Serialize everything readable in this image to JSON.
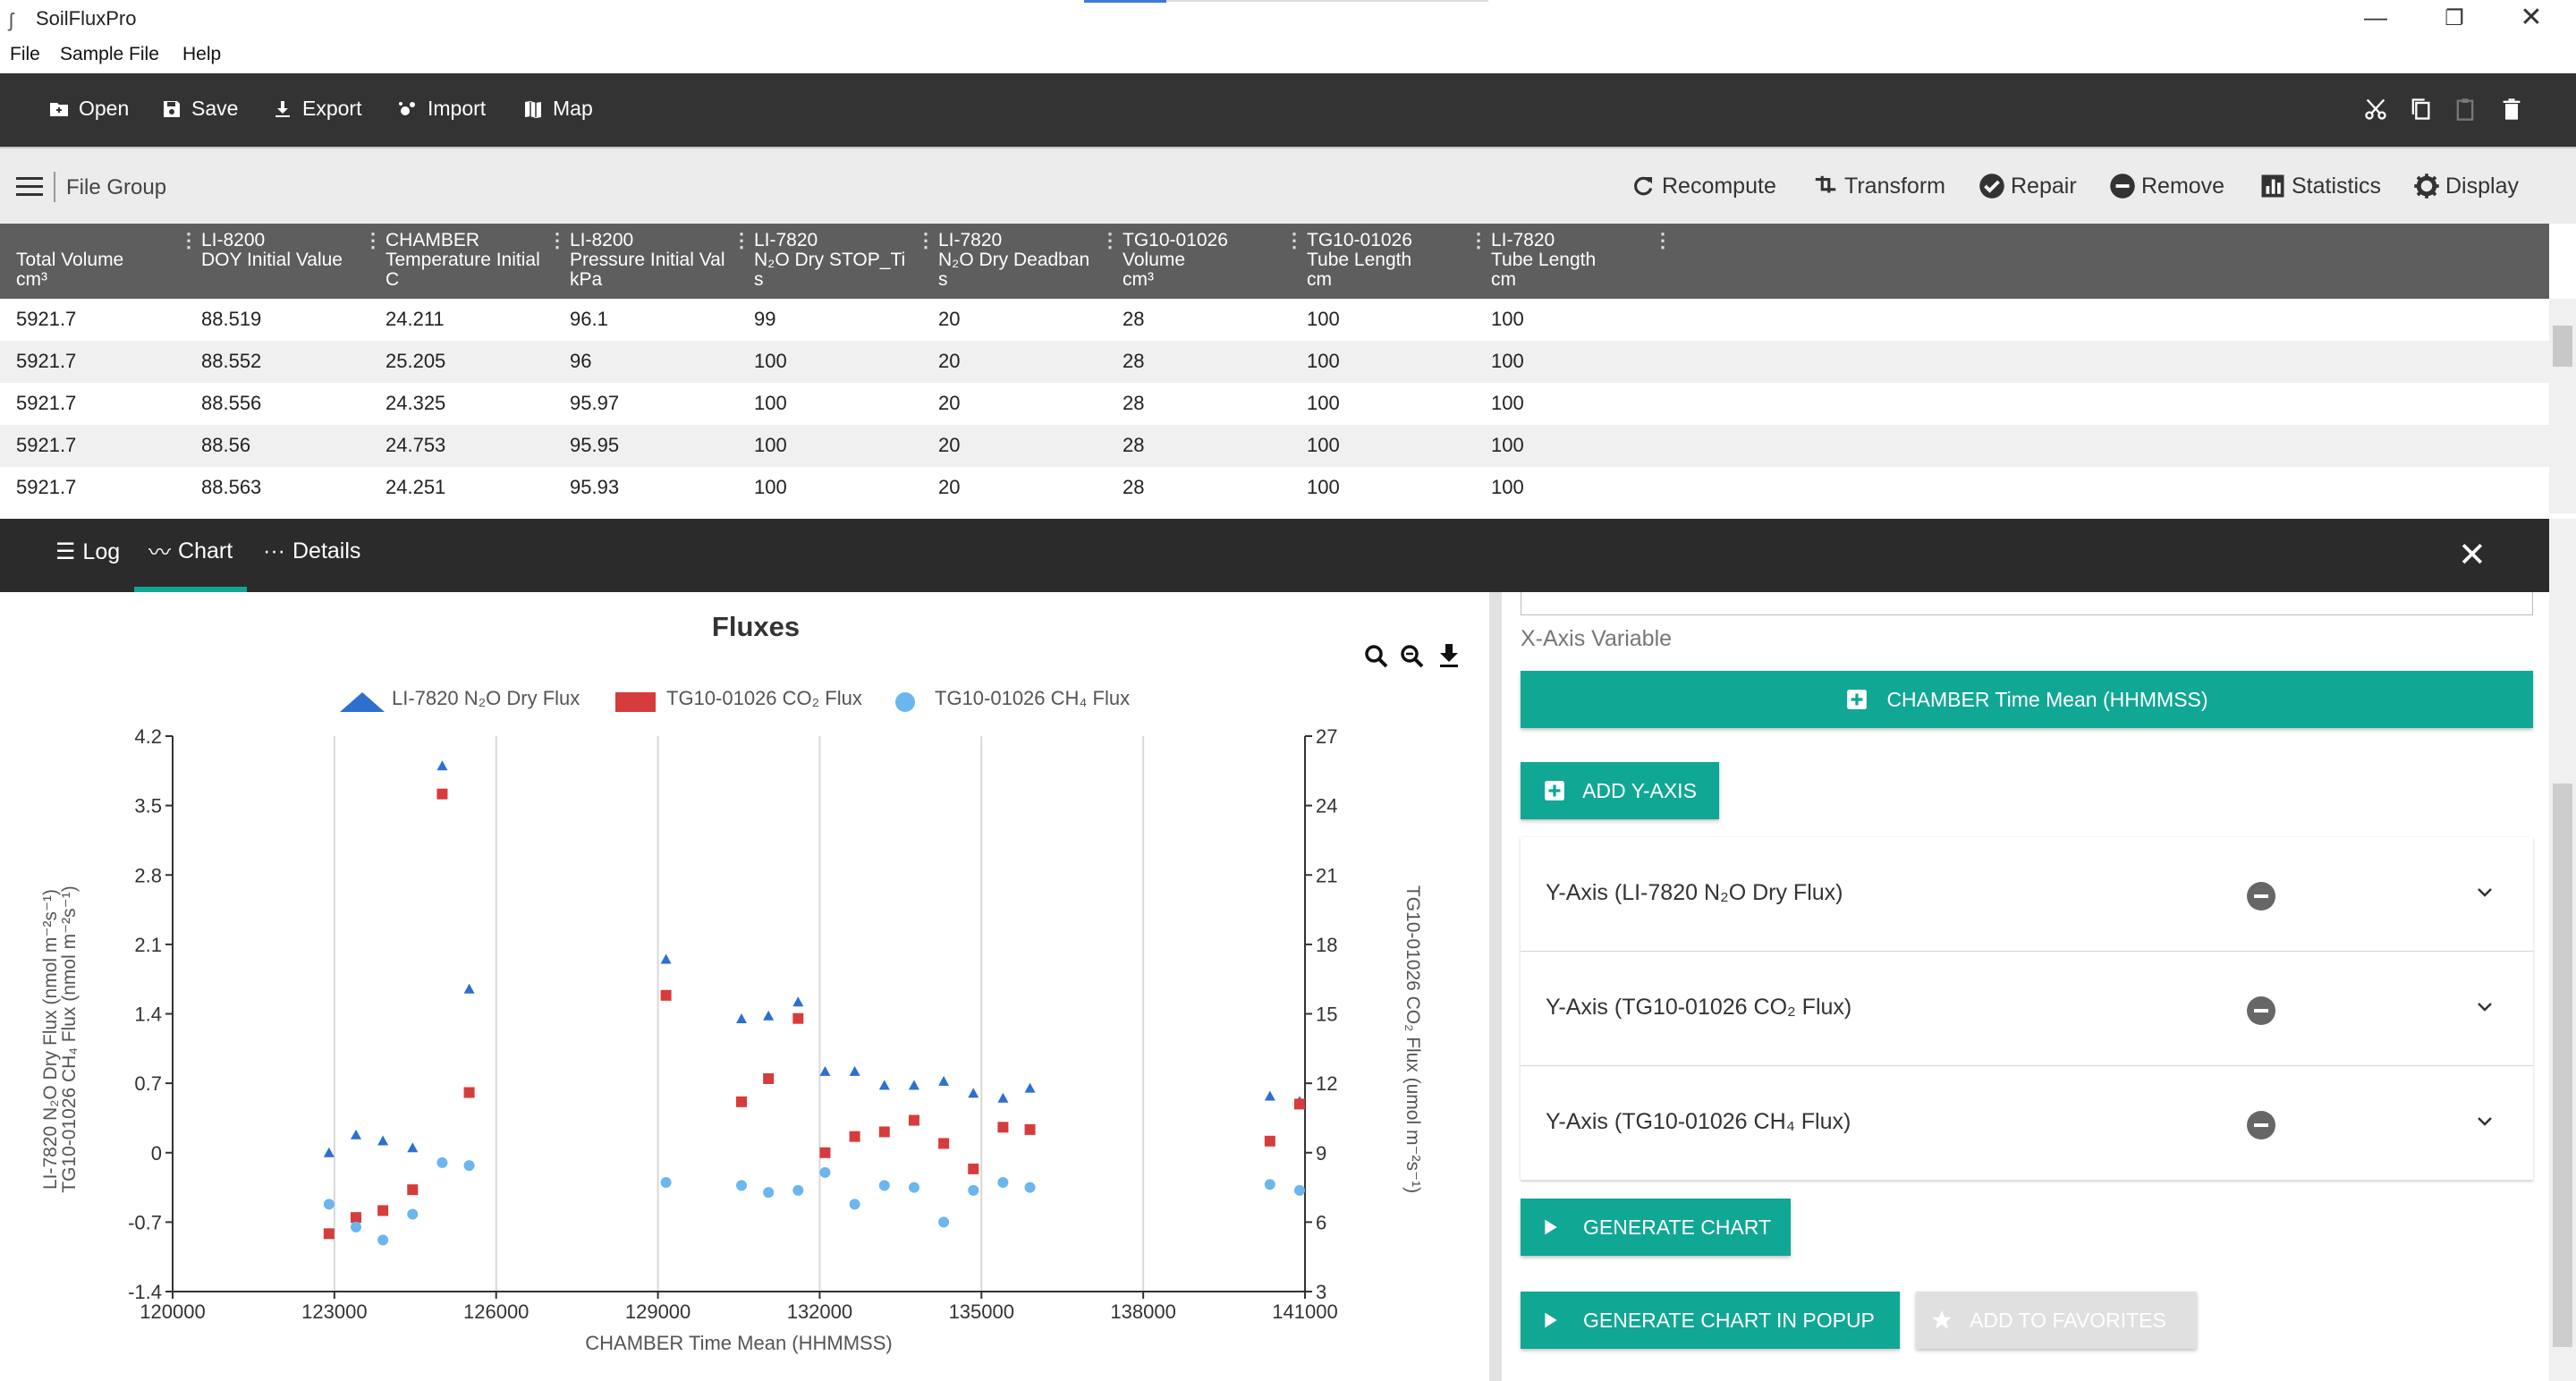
{
  "window": {
    "title": "SoilFluxPro"
  },
  "menu": {
    "items": [
      "File",
      "Sample File",
      "Help"
    ]
  },
  "toolbar": {
    "open": "Open",
    "save": "Save",
    "export": "Export",
    "import": "Import",
    "map": "Map"
  },
  "group_bar": {
    "title": "File Group",
    "actions": {
      "recompute": "Recompute",
      "transform": "Transform",
      "repair": "Repair",
      "remove": "Remove",
      "statistics": "Statistics",
      "display": "Display"
    }
  },
  "table": {
    "columns": [
      "\nTotal Volume\ncm³",
      "LI-8200\nDOY Initial Value\n",
      "CHAMBER\nTemperature Initial\nC",
      "LI-8200\nPressure Initial Val\nkPa",
      "LI-7820\nN₂O Dry STOP_Ti\ns",
      "LI-7820\nN₂O Dry Deadban\ns",
      "TG10-01026\nVolume\ncm³",
      "TG10-01026\nTube Length\ncm",
      "LI-7820\nTube Length\ncm"
    ],
    "rows": [
      [
        "5921.7",
        "88.519",
        "24.211",
        "96.1",
        "99",
        "20",
        "28",
        "100",
        "100"
      ],
      [
        "5921.7",
        "88.552",
        "25.205",
        "96",
        "100",
        "20",
        "28",
        "100",
        "100"
      ],
      [
        "5921.7",
        "88.556",
        "24.325",
        "95.97",
        "100",
        "20",
        "28",
        "100",
        "100"
      ],
      [
        "5921.7",
        "88.56",
        "24.753",
        "95.95",
        "100",
        "20",
        "28",
        "100",
        "100"
      ],
      [
        "5921.7",
        "88.563",
        "24.251",
        "95.93",
        "100",
        "20",
        "28",
        "100",
        "100"
      ]
    ]
  },
  "tabs": {
    "log": "Log",
    "chart": "Chart",
    "details": "Details",
    "active": "Chart"
  },
  "right_panel": {
    "x_axis_label": "X-Axis Variable",
    "x_axis_value": "CHAMBER Time Mean (HHMMSS)",
    "add_y_axis": "ADD Y-AXIS",
    "y_axes": [
      "Y-Axis (LI-7820 N₂O Dry Flux)",
      "Y-Axis (TG10-01026 CO₂ Flux)",
      "Y-Axis (TG10-01026 CH₄ Flux)"
    ],
    "generate_chart": "GENERATE CHART",
    "generate_popup": "GENERATE CHART IN POPUP",
    "add_favorites": "ADD TO FAVORITES"
  },
  "colors": {
    "teal": "#11a795",
    "dark": "#333333",
    "n2o": "#2e6fd0",
    "co2": "#d63c3c",
    "ch4": "#6bb6ee"
  },
  "chart_data": {
    "type": "scatter",
    "title": "Fluxes",
    "xlabel": "CHAMBER Time Mean (HHMMSS)",
    "ylabel_left": [
      "LI-7820 N₂O Dry Flux (nmol m⁻²s⁻¹)",
      "TG10-01026 CH₄ Flux (nmol m⁻²s⁻¹)"
    ],
    "ylabel_right": "TG10-01026 CO₂ Flux (umol m⁻²s⁻¹)",
    "xlim": [
      120000,
      141000
    ],
    "x_ticks": [
      "120000",
      "123000",
      "126000",
      "129000",
      "132000",
      "135000",
      "138000",
      "141000"
    ],
    "y_left_lim": [
      -1.4,
      4.2
    ],
    "y_left_ticks": [
      "4.2",
      "3.5",
      "2.8",
      "2.1",
      "1.4",
      "0.7",
      "0",
      "-0.7",
      "-1.4"
    ],
    "y_right_lim": [
      3,
      27
    ],
    "y_right_ticks": [
      "27",
      "24",
      "21",
      "18",
      "15",
      "12",
      "9",
      "6",
      "3"
    ],
    "legend": [
      "LI-7820 N₂O Dry Flux",
      "TG10-01026 CO₂ Flux",
      "TG10-01026 CH₄ Flux"
    ],
    "legend_position": "top",
    "grid": true,
    "series": [
      {
        "name": "LI-7820 N₂O Dry Flux",
        "axis": "left",
        "marker": "triangle",
        "points": [
          [
            122900,
            0.0
          ],
          [
            123400,
            0.18
          ],
          [
            123900,
            0.12
          ],
          [
            124450,
            0.05
          ],
          [
            125000,
            3.9
          ],
          [
            125500,
            1.65
          ],
          [
            129150,
            1.95
          ],
          [
            130550,
            1.35
          ],
          [
            131050,
            1.38
          ],
          [
            131600,
            1.52
          ],
          [
            132100,
            0.82
          ],
          [
            132650,
            0.82
          ],
          [
            133200,
            0.68
          ],
          [
            133750,
            0.68
          ],
          [
            134300,
            0.72
          ],
          [
            134850,
            0.6
          ],
          [
            135400,
            0.55
          ],
          [
            135900,
            0.65
          ],
          [
            140350,
            0.57
          ],
          [
            140900,
            0.52
          ]
        ]
      },
      {
        "name": "TG10-01026 CO₂ Flux",
        "axis": "right",
        "marker": "square",
        "points": [
          [
            122900,
            5.5
          ],
          [
            123400,
            6.2
          ],
          [
            123900,
            6.5
          ],
          [
            124450,
            7.4
          ],
          [
            125000,
            24.5
          ],
          [
            125500,
            11.6
          ],
          [
            129150,
            15.8
          ],
          [
            130550,
            11.2
          ],
          [
            131050,
            12.2
          ],
          [
            131600,
            14.8
          ],
          [
            132100,
            9.0
          ],
          [
            132650,
            9.7
          ],
          [
            133200,
            9.9
          ],
          [
            133750,
            10.4
          ],
          [
            134300,
            9.4
          ],
          [
            134850,
            8.3
          ],
          [
            135400,
            10.1
          ],
          [
            135900,
            10.0
          ],
          [
            140350,
            9.5
          ],
          [
            140900,
            11.1
          ]
        ]
      },
      {
        "name": "TG10-01026 CH₄ Flux",
        "axis": "left",
        "marker": "circle",
        "points": [
          [
            122900,
            -0.52
          ],
          [
            123400,
            -0.75
          ],
          [
            123900,
            -0.88
          ],
          [
            124450,
            -0.62
          ],
          [
            125000,
            -0.1
          ],
          [
            125500,
            -0.13
          ],
          [
            129150,
            -0.3
          ],
          [
            130550,
            -0.33
          ],
          [
            131050,
            -0.4
          ],
          [
            131600,
            -0.38
          ],
          [
            132100,
            -0.2
          ],
          [
            132650,
            -0.52
          ],
          [
            133200,
            -0.33
          ],
          [
            133750,
            -0.35
          ],
          [
            134300,
            -0.7
          ],
          [
            134850,
            -0.38
          ],
          [
            135400,
            -0.3
          ],
          [
            135900,
            -0.35
          ],
          [
            140350,
            -0.32
          ],
          [
            140900,
            -0.38
          ]
        ]
      }
    ]
  }
}
